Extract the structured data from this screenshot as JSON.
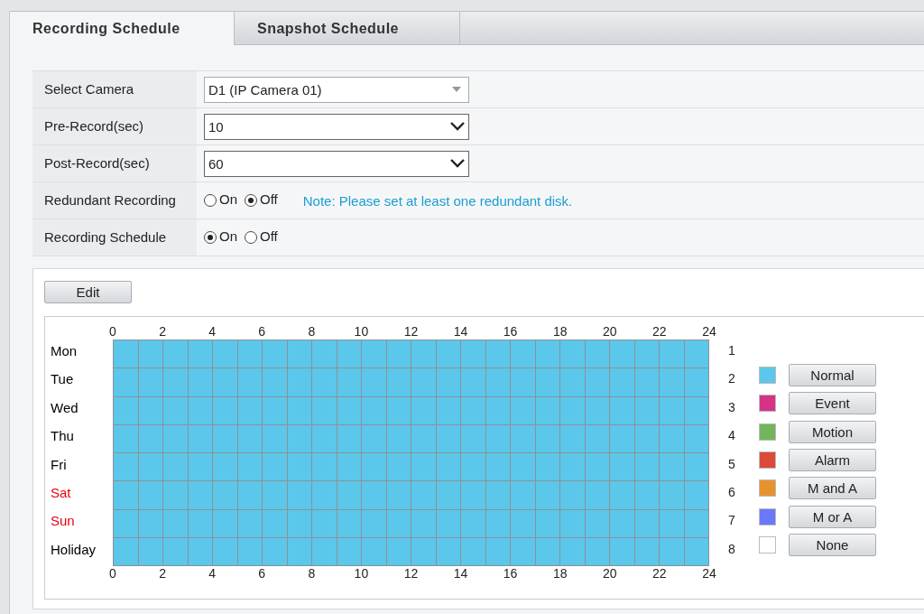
{
  "tabs": [
    {
      "label": "Recording Schedule",
      "selected": true
    },
    {
      "label": "Snapshot Schedule",
      "selected": false
    }
  ],
  "settings": [
    {
      "kind": "select",
      "label": "Select Camera",
      "value": "D1 (IP Camera 01)",
      "disabled": true
    },
    {
      "kind": "select",
      "label": "Pre-Record(sec)",
      "value": "10",
      "disabled": false
    },
    {
      "kind": "select",
      "label": "Post-Record(sec)",
      "value": "60",
      "disabled": false
    },
    {
      "kind": "radio",
      "label": "Redundant Recording",
      "options": [
        {
          "label": "On",
          "selected": false
        },
        {
          "label": "Off",
          "selected": true
        }
      ],
      "note": "Note: Please set at least one redundant disk."
    },
    {
      "kind": "radio",
      "label": "Recording Schedule",
      "options": [
        {
          "label": "On",
          "selected": true
        },
        {
          "label": "Off",
          "selected": false
        }
      ]
    }
  ],
  "edit_button": "Edit",
  "schedule": {
    "top_axis": [
      "0",
      "2",
      "4",
      "6",
      "8",
      "10",
      "12",
      "14",
      "16",
      "18",
      "20",
      "22",
      "24"
    ],
    "bottom_axis": [
      "0",
      "2",
      "4",
      "6",
      "8",
      "10",
      "12",
      "14",
      "16",
      "18",
      "20",
      "22",
      "24"
    ],
    "days": [
      {
        "day": "Mon",
        "color": "#000000",
        "number": "1",
        "slots": [
          {
            "kind": "normal"
          },
          {
            "kind": "normal"
          },
          {
            "kind": "normal"
          },
          {
            "kind": "normal"
          },
          {
            "kind": "normal"
          },
          {
            "kind": "normal"
          },
          {
            "kind": "normal"
          },
          {
            "kind": "normal"
          },
          {
            "kind": "normal"
          },
          {
            "kind": "normal"
          },
          {
            "kind": "normal"
          },
          {
            "kind": "normal"
          },
          {
            "kind": "normal"
          },
          {
            "kind": "normal"
          },
          {
            "kind": "normal"
          },
          {
            "kind": "normal"
          },
          {
            "kind": "normal"
          },
          {
            "kind": "normal"
          },
          {
            "kind": "normal"
          },
          {
            "kind": "normal"
          },
          {
            "kind": "normal"
          },
          {
            "kind": "normal"
          },
          {
            "kind": "normal"
          },
          {
            "kind": "normal"
          }
        ]
      },
      {
        "day": "Tue",
        "color": "#000000",
        "number": "2",
        "slots": [
          {
            "kind": "normal"
          },
          {
            "kind": "normal"
          },
          {
            "kind": "normal"
          },
          {
            "kind": "normal"
          },
          {
            "kind": "normal"
          },
          {
            "kind": "normal"
          },
          {
            "kind": "normal"
          },
          {
            "kind": "normal"
          },
          {
            "kind": "normal"
          },
          {
            "kind": "normal"
          },
          {
            "kind": "normal"
          },
          {
            "kind": "normal"
          },
          {
            "kind": "normal"
          },
          {
            "kind": "normal"
          },
          {
            "kind": "normal"
          },
          {
            "kind": "normal"
          },
          {
            "kind": "normal"
          },
          {
            "kind": "normal"
          },
          {
            "kind": "normal"
          },
          {
            "kind": "normal"
          },
          {
            "kind": "normal"
          },
          {
            "kind": "normal"
          },
          {
            "kind": "normal"
          },
          {
            "kind": "normal"
          }
        ]
      },
      {
        "day": "Wed",
        "color": "#000000",
        "number": "3",
        "slots": [
          {
            "kind": "normal"
          },
          {
            "kind": "normal"
          },
          {
            "kind": "normal"
          },
          {
            "kind": "normal"
          },
          {
            "kind": "normal"
          },
          {
            "kind": "normal"
          },
          {
            "kind": "normal"
          },
          {
            "kind": "normal"
          },
          {
            "kind": "normal"
          },
          {
            "kind": "normal"
          },
          {
            "kind": "normal"
          },
          {
            "kind": "normal"
          },
          {
            "kind": "normal"
          },
          {
            "kind": "normal"
          },
          {
            "kind": "normal"
          },
          {
            "kind": "normal"
          },
          {
            "kind": "normal"
          },
          {
            "kind": "normal"
          },
          {
            "kind": "normal"
          },
          {
            "kind": "normal"
          },
          {
            "kind": "normal"
          },
          {
            "kind": "normal"
          },
          {
            "kind": "normal"
          },
          {
            "kind": "normal"
          }
        ]
      },
      {
        "day": "Thu",
        "color": "#000000",
        "number": "4",
        "slots": [
          {
            "kind": "normal"
          },
          {
            "kind": "normal"
          },
          {
            "kind": "normal"
          },
          {
            "kind": "normal"
          },
          {
            "kind": "normal"
          },
          {
            "kind": "normal"
          },
          {
            "kind": "normal"
          },
          {
            "kind": "normal"
          },
          {
            "kind": "normal"
          },
          {
            "kind": "normal"
          },
          {
            "kind": "normal"
          },
          {
            "kind": "normal"
          },
          {
            "kind": "normal"
          },
          {
            "kind": "normal"
          },
          {
            "kind": "normal"
          },
          {
            "kind": "normal"
          },
          {
            "kind": "normal"
          },
          {
            "kind": "normal"
          },
          {
            "kind": "normal"
          },
          {
            "kind": "normal"
          },
          {
            "kind": "normal"
          },
          {
            "kind": "normal"
          },
          {
            "kind": "normal"
          },
          {
            "kind": "normal"
          }
        ]
      },
      {
        "day": "Fri",
        "color": "#000000",
        "number": "5",
        "slots": [
          {
            "kind": "normal"
          },
          {
            "kind": "normal"
          },
          {
            "kind": "normal"
          },
          {
            "kind": "normal"
          },
          {
            "kind": "normal"
          },
          {
            "kind": "normal"
          },
          {
            "kind": "normal"
          },
          {
            "kind": "normal"
          },
          {
            "kind": "normal"
          },
          {
            "kind": "normal"
          },
          {
            "kind": "normal"
          },
          {
            "kind": "normal"
          },
          {
            "kind": "normal"
          },
          {
            "kind": "normal"
          },
          {
            "kind": "normal"
          },
          {
            "kind": "normal"
          },
          {
            "kind": "normal"
          },
          {
            "kind": "normal"
          },
          {
            "kind": "normal"
          },
          {
            "kind": "normal"
          },
          {
            "kind": "normal"
          },
          {
            "kind": "normal"
          },
          {
            "kind": "normal"
          },
          {
            "kind": "normal"
          }
        ]
      },
      {
        "day": "Sat",
        "color": "#e60012",
        "number": "6",
        "slots": [
          {
            "kind": "normal"
          },
          {
            "kind": "normal"
          },
          {
            "kind": "normal"
          },
          {
            "kind": "normal"
          },
          {
            "kind": "normal"
          },
          {
            "kind": "normal"
          },
          {
            "kind": "normal"
          },
          {
            "kind": "normal"
          },
          {
            "kind": "normal"
          },
          {
            "kind": "normal"
          },
          {
            "kind": "normal"
          },
          {
            "kind": "normal"
          },
          {
            "kind": "normal"
          },
          {
            "kind": "normal"
          },
          {
            "kind": "normal"
          },
          {
            "kind": "normal"
          },
          {
            "kind": "normal"
          },
          {
            "kind": "normal"
          },
          {
            "kind": "normal"
          },
          {
            "kind": "normal"
          },
          {
            "kind": "normal"
          },
          {
            "kind": "normal"
          },
          {
            "kind": "normal"
          },
          {
            "kind": "normal"
          }
        ]
      },
      {
        "day": "Sun",
        "color": "#e60012",
        "number": "7",
        "slots": [
          {
            "kind": "normal"
          },
          {
            "kind": "normal"
          },
          {
            "kind": "normal"
          },
          {
            "kind": "normal"
          },
          {
            "kind": "normal"
          },
          {
            "kind": "normal"
          },
          {
            "kind": "normal"
          },
          {
            "kind": "normal"
          },
          {
            "kind": "normal"
          },
          {
            "kind": "normal"
          },
          {
            "kind": "normal"
          },
          {
            "kind": "normal"
          },
          {
            "kind": "normal"
          },
          {
            "kind": "normal"
          },
          {
            "kind": "normal"
          },
          {
            "kind": "normal"
          },
          {
            "kind": "normal"
          },
          {
            "kind": "normal"
          },
          {
            "kind": "normal"
          },
          {
            "kind": "normal"
          },
          {
            "kind": "normal"
          },
          {
            "kind": "normal"
          },
          {
            "kind": "normal"
          },
          {
            "kind": "normal"
          }
        ]
      },
      {
        "day": "Holiday",
        "color": "#000000",
        "number": "8",
        "slots": [
          {
            "kind": "normal"
          },
          {
            "kind": "normal"
          },
          {
            "kind": "normal"
          },
          {
            "kind": "normal"
          },
          {
            "kind": "normal"
          },
          {
            "kind": "normal"
          },
          {
            "kind": "normal"
          },
          {
            "kind": "normal"
          },
          {
            "kind": "normal"
          },
          {
            "kind": "normal"
          },
          {
            "kind": "normal"
          },
          {
            "kind": "normal"
          },
          {
            "kind": "normal"
          },
          {
            "kind": "normal"
          },
          {
            "kind": "normal"
          },
          {
            "kind": "normal"
          },
          {
            "kind": "normal"
          },
          {
            "kind": "normal"
          },
          {
            "kind": "normal"
          },
          {
            "kind": "normal"
          },
          {
            "kind": "normal"
          },
          {
            "kind": "normal"
          },
          {
            "kind": "normal"
          },
          {
            "kind": "normal"
          }
        ]
      }
    ],
    "legend": [
      {
        "kind": "normal",
        "label": "Normal",
        "color": "#5bc7ea"
      },
      {
        "kind": "event",
        "label": "Event",
        "color": "#d63386"
      },
      {
        "kind": "motion",
        "label": "Motion",
        "color": "#72b55a"
      },
      {
        "kind": "alarm",
        "label": "Alarm",
        "color": "#dc4a3a"
      },
      {
        "kind": "m_and_a",
        "label": "M and A",
        "color": "#e8922e"
      },
      {
        "kind": "m_or_a",
        "label": "M or A",
        "color": "#6a78fa"
      },
      {
        "kind": "none",
        "label": "None",
        "color": "#ffffff"
      }
    ]
  }
}
